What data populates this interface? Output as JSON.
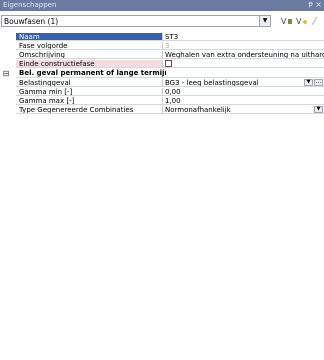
{
  "panel": {
    "title": "Eigenschappen",
    "pin_glyph": "ᵽ",
    "close_glyph": "×"
  },
  "object_select": {
    "value": "Bouwfasen (1)"
  },
  "toolbar": {
    "filter_icon_a": "V",
    "filter_icon_b": "V",
    "pencil_icon": "/"
  },
  "grid": {
    "naam": {
      "label": "Naam",
      "value": "ST3"
    },
    "fase_volgorde": {
      "label": "Fase volgorde",
      "value": "3"
    },
    "omschrijving": {
      "label": "Omschrijving",
      "value": "Weghalen van extra ondersteuning na uitharde..."
    },
    "einde": {
      "label": "Einde constructiefase",
      "checked": false
    },
    "category": {
      "label": "Bel. geval permanent of lange termijn",
      "expander": "⊟"
    },
    "belastinggeval": {
      "label": "Belastinggeval",
      "value": "BG3 - leeg belastingsgeval"
    },
    "gamma_min": {
      "label": "Gamma min [-]",
      "value": "0,00"
    },
    "gamma_max": {
      "label": "Gamma max [-]",
      "value": "1,00"
    },
    "type_comb": {
      "label": "Type Gegenereerde Combinaties",
      "value": "Normonafhankelijk"
    }
  },
  "colors": {
    "titlebar": "#6a7aa0",
    "selection": "#3860a8",
    "pink_row": "#f4dce0"
  }
}
